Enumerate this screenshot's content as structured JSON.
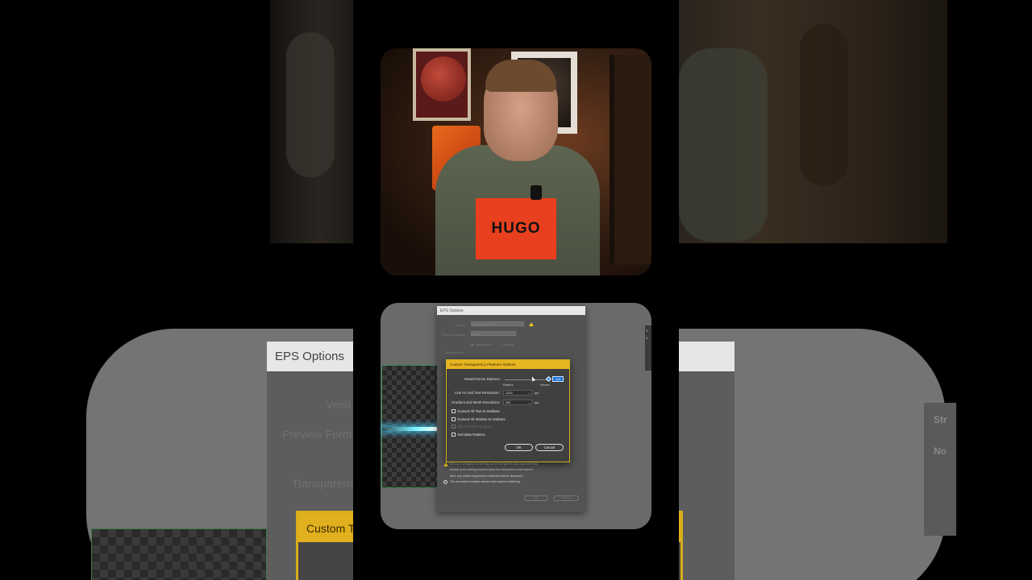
{
  "video": {
    "shirt_logo": "HUGO"
  },
  "background": {
    "dialog_title": "EPS Options",
    "version_label": "Versi",
    "preview_label": "Preview Form",
    "transparency_label": "Transparenc",
    "custom_title": "Custom Tr",
    "right_panel_top": "Str",
    "right_panel_bottom": "No"
  },
  "eps": {
    "title": "EPS Options",
    "version_label": "Version:",
    "version_value": "Illustrator 10 EPS",
    "preview_label": "Preview Format:",
    "preview_value": "None",
    "radio_transparent": "Transparent",
    "radio_opaque": "Opaque",
    "transparency_label": "Transparency",
    "warning_1": "Saving to a legacy format may convert all type to point type and may",
    "warning_2": "disable some editing features when the document is read back in.",
    "warning_3": "Also, any hidden Appearance attributes will be discarded.",
    "info_1": "The document contains artwork that requires flattening.",
    "ok": "OK",
    "cancel": "Cancel"
  },
  "custom_flattener": {
    "title": "Custom Transparency Flattener Options",
    "balance_label": "Raster/Vector Balance:",
    "balance_value": "100",
    "rasters_label": "Rasters",
    "vectors_label": "Vectors",
    "lineart_label": "Line Art and Text Resolution:",
    "lineart_value": "1200",
    "gradient_label": "Gradient and Mesh Resolution:",
    "gradient_value": "300",
    "unit": "ppi",
    "checkboxes": [
      {
        "label": "Convert All Text to Outlines",
        "checked": false,
        "enabled": true
      },
      {
        "label": "Convert All Strokes to Outlines",
        "checked": false,
        "enabled": true
      },
      {
        "label": "Clip Complex Regions",
        "checked": false,
        "enabled": false
      },
      {
        "label": "Anti-alias Rasters",
        "checked": false,
        "enabled": true
      }
    ],
    "ok": "OK",
    "cancel": "Cancel"
  },
  "colors": {
    "accent_yellow": "#e7b520",
    "selection_blue": "#1a6fd8",
    "shirt_logo": "#e8401e"
  }
}
